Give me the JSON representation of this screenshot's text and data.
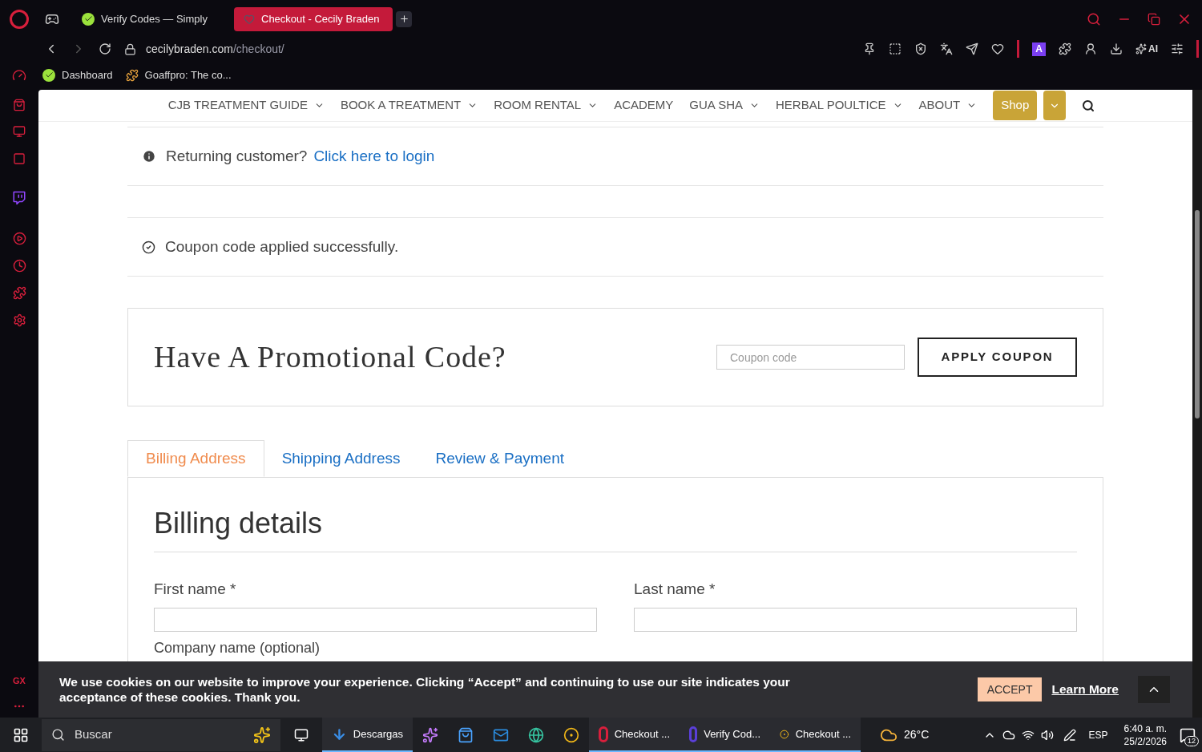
{
  "browser": {
    "tabs": [
      {
        "label": "Verify Codes — Simply",
        "selected": false
      },
      {
        "label": "Checkout - Cecily Braden",
        "selected": true
      }
    ],
    "address": {
      "domain": "cecilybraden.com",
      "path": "/checkout/"
    },
    "bookmarks": [
      {
        "label": "Dashboard",
        "kind": "check"
      },
      {
        "label": "Goaffpro: The co...",
        "kind": "puzzle"
      }
    ],
    "badge": "A",
    "ai_label": "AI"
  },
  "sidebar": {
    "label": "GX"
  },
  "site_nav": {
    "items": [
      {
        "label": "CJB TREATMENT GUIDE",
        "dropdown": true
      },
      {
        "label": "BOOK A TREATMENT",
        "dropdown": true
      },
      {
        "label": "ROOM RENTAL",
        "dropdown": true
      },
      {
        "label": "ACADEMY",
        "dropdown": false
      },
      {
        "label": "GUA SHA",
        "dropdown": true
      },
      {
        "label": "HERBAL POULTICE",
        "dropdown": true
      },
      {
        "label": "ABOUT",
        "dropdown": true
      }
    ],
    "shop": "Shop"
  },
  "notices": [
    {
      "kind": "info",
      "text": "Returning customer?",
      "link": "Click here to login"
    },
    {
      "kind": "success",
      "text": "Coupon code applied successfully."
    }
  ],
  "promo": {
    "title": "Have A Promotional Code?",
    "placeholder": "Coupon code",
    "button": "APPLY COUPON"
  },
  "checkout_tabs": [
    {
      "label": "Billing Address",
      "selected": true
    },
    {
      "label": "Shipping Address",
      "selected": false
    },
    {
      "label": "Review & Payment",
      "selected": false
    }
  ],
  "billing": {
    "title": "Billing details",
    "fields": [
      {
        "label": "First name",
        "marker": "*"
      },
      {
        "label": "Last name",
        "marker": "*"
      }
    ],
    "next_label": "Company name (optional)"
  },
  "cookie": {
    "text": "We use cookies on our website to improve your experience. Clicking “Accept” and continuing to use our site indicates your acceptance of these cookies. Thank you.",
    "accept": "ACCEPT",
    "learn_more": "Learn More"
  },
  "taskbar": {
    "search": "Buscar",
    "apps": [
      {
        "kind": "download",
        "label": "Descargas",
        "running": true
      },
      {
        "kind": "copilot",
        "running": false
      },
      {
        "kind": "store",
        "running": false
      },
      {
        "kind": "mail",
        "running": false
      },
      {
        "kind": "edge",
        "running": false
      },
      {
        "kind": "chrome",
        "running": false
      },
      {
        "kind": "opera",
        "label": "Checkout ...",
        "running": true
      },
      {
        "kind": "opera-blue",
        "label": "Verify Cod...",
        "running": true
      },
      {
        "kind": "chrome",
        "label": "Checkout ...",
        "running": true
      }
    ],
    "weather": "26°C",
    "lang": "ESP",
    "time": "6:40 a. m.",
    "date": "25/2/2026",
    "notifications": "12"
  }
}
